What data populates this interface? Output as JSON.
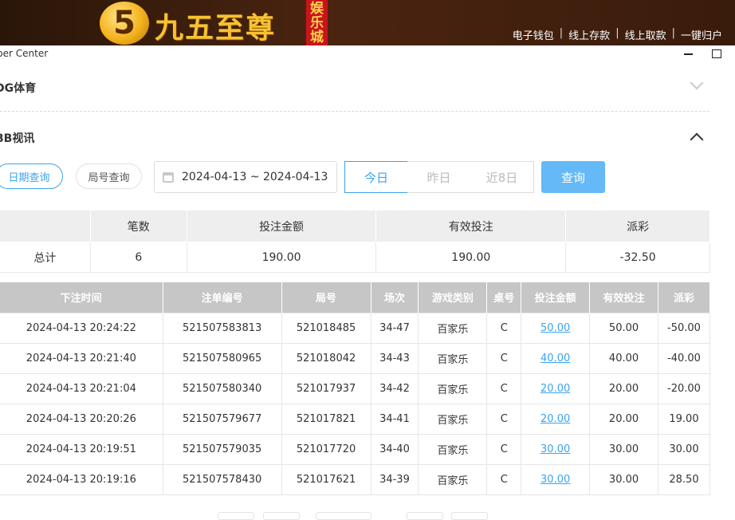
{
  "header": {
    "logo_digit": "5",
    "logo_text": "九五至尊",
    "logo_tag": "娱乐城",
    "links": [
      "电子钱包",
      "线上存款",
      "线上取款",
      "一键归户"
    ],
    "separator": "|"
  },
  "window": {
    "title": "ber Center"
  },
  "sections": [
    {
      "title": "DG体育",
      "expanded": false
    },
    {
      "title": "BB视讯",
      "expanded": true
    }
  ],
  "filters": {
    "date_query": "日期查询",
    "round_query": "局号查询",
    "date_range": "2024-04-13 ~ 2024-04-13",
    "today": "今日",
    "yesterday": "昨日",
    "last8": "近8日",
    "query": "查询"
  },
  "summary": {
    "headers": [
      "",
      "笔数",
      "投注金额",
      "有效投注",
      "派彩"
    ],
    "row": [
      "总计",
      "6",
      "190.00",
      "190.00",
      "-32.50"
    ]
  },
  "details": {
    "headers": [
      "下注时间",
      "注单编号",
      "局号",
      "场次",
      "游戏类别",
      "桌号",
      "投注金额",
      "有效投注",
      "派彩"
    ],
    "rows": [
      [
        "2024-04-13 20:24:22",
        "521507583813",
        "521018485",
        "34-47",
        "百家乐",
        "C",
        "50.00",
        "50.00",
        "-50.00"
      ],
      [
        "2024-04-13 20:21:40",
        "521507580965",
        "521018042",
        "34-43",
        "百家乐",
        "C",
        "40.00",
        "40.00",
        "-40.00"
      ],
      [
        "2024-04-13 20:21:04",
        "521507580340",
        "521017937",
        "34-42",
        "百家乐",
        "C",
        "20.00",
        "20.00",
        "-20.00"
      ],
      [
        "2024-04-13 20:20:26",
        "521507579677",
        "521017821",
        "34-41",
        "百家乐",
        "C",
        "20.00",
        "20.00",
        "19.00"
      ],
      [
        "2024-04-13 20:19:51",
        "521507579035",
        "521017720",
        "34-40",
        "百家乐",
        "C",
        "30.00",
        "30.00",
        "30.00"
      ],
      [
        "2024-04-13 20:19:16",
        "521507578430",
        "521017621",
        "34-39",
        "百家乐",
        "C",
        "30.00",
        "30.00",
        "28.50"
      ]
    ]
  },
  "colors": {
    "accent": "#3aa3f0",
    "negative": "#e8474f",
    "header_bg": "#3a1c0c"
  }
}
